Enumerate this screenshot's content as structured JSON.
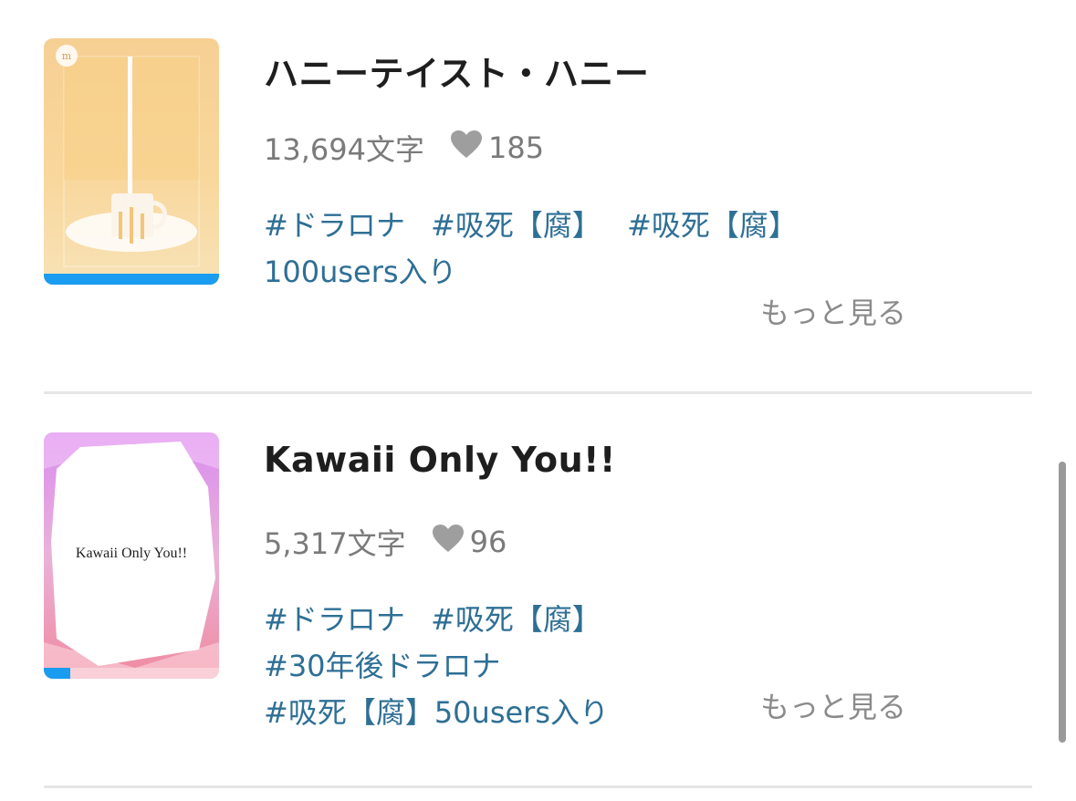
{
  "works": [
    {
      "title": "ハニーテイスト・ハニー",
      "char_count": "13,694文字",
      "likes": "185",
      "tags": [
        "#ドラロナ",
        "#吸死【腐】",
        "#吸死【腐】100users入り"
      ],
      "more": "もっと見る",
      "read_progress": 1.0,
      "cover_text": ""
    },
    {
      "title": "Kawaii Only You!!",
      "char_count": "5,317文字",
      "likes": "96",
      "tags": [
        "#ドラロナ",
        "#吸死【腐】",
        "#30年後ドラロナ",
        "#吸死【腐】50users入り"
      ],
      "more": "もっと見る",
      "read_progress": 0.15,
      "cover_text": "Kawaii Only You!!"
    }
  ],
  "colors": {
    "tag": "#2e6f95",
    "progress": "#1a9cf0",
    "heart": "#9e9e9e"
  }
}
